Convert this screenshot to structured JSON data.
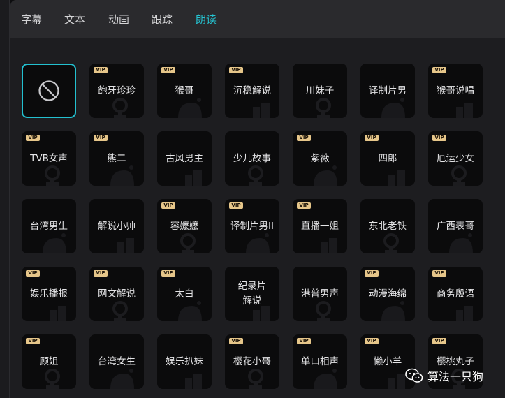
{
  "tabs": [
    {
      "label": "字幕",
      "active": false
    },
    {
      "label": "文本",
      "active": false
    },
    {
      "label": "动画",
      "active": false
    },
    {
      "label": "跟踪",
      "active": false
    },
    {
      "label": "朗读",
      "active": true
    }
  ],
  "accent_color": "#25c3d1",
  "vip_label": "VIP",
  "none_option": {
    "icon": "no-voice-icon",
    "selected": true
  },
  "voices": [
    {
      "name": "飽牙珍珍",
      "vip": true
    },
    {
      "name": "猴哥",
      "vip": true
    },
    {
      "name": "沉稳解说",
      "vip": true
    },
    {
      "name": "川妹子",
      "vip": false
    },
    {
      "name": "译制片男",
      "vip": false
    },
    {
      "name": "猴哥说唱",
      "vip": true
    },
    {
      "name": "TVB女声",
      "vip": true
    },
    {
      "name": "熊二",
      "vip": true
    },
    {
      "name": "古风男主",
      "vip": false
    },
    {
      "name": "少儿故事",
      "vip": false
    },
    {
      "name": "紫薇",
      "vip": true
    },
    {
      "name": "四郎",
      "vip": true
    },
    {
      "name": "厄运少女",
      "vip": true
    },
    {
      "name": "台湾男生",
      "vip": false
    },
    {
      "name": "解说小帅",
      "vip": false
    },
    {
      "name": "容嬷嬷",
      "vip": true
    },
    {
      "name": "译制片男II",
      "vip": true
    },
    {
      "name": "直播一姐",
      "vip": true
    },
    {
      "name": "东北老铁",
      "vip": false
    },
    {
      "name": "广西表哥",
      "vip": false
    },
    {
      "name": "娱乐播报",
      "vip": true
    },
    {
      "name": "网文解说",
      "vip": true
    },
    {
      "name": "太白",
      "vip": true
    },
    {
      "name_lines": [
        "纪录片",
        "解说"
      ],
      "vip": false
    },
    {
      "name": "港普男声",
      "vip": false
    },
    {
      "name": "动漫海绵",
      "vip": true
    },
    {
      "name": "商务殷语",
      "vip": true
    },
    {
      "name": "顾姐",
      "vip": true
    },
    {
      "name": "台湾女生",
      "vip": false
    },
    {
      "name": "娱乐扒妹",
      "vip": false
    },
    {
      "name": "樱花小哥",
      "vip": true
    },
    {
      "name": "单口相声",
      "vip": true
    },
    {
      "name": "懒小羊",
      "vip": true
    },
    {
      "name": "樱桃丸子",
      "vip": true
    }
  ],
  "watermark": {
    "text": "算法一只狗",
    "icon": "wechat-icon"
  }
}
